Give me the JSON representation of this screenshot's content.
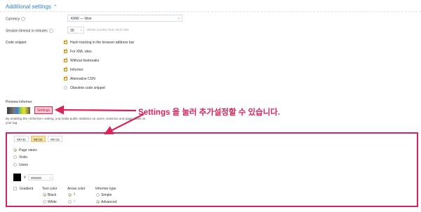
{
  "section": {
    "title": "Additional settings",
    "chevron_icon": "chevron-up-icon"
  },
  "currency": {
    "label": "Currency",
    "value": "KRW — Won"
  },
  "session_timeout": {
    "label": "Session timeout in minutes",
    "value": "30",
    "hint": "Whole number from 30 to 360"
  },
  "code_snippet": {
    "label": "Code snippet",
    "options": [
      {
        "label": "Hash tracking in the browser address bar",
        "checked": true
      },
      {
        "label": "For XML sites",
        "checked": true
      },
      {
        "label": "Without linebreaks",
        "checked": true
      },
      {
        "label": "Informer",
        "checked": true
      },
      {
        "label": "Alternative CDN",
        "checked": true
      },
      {
        "label": "Obsolete code snippet",
        "checked": false
      }
    ]
  },
  "preview": {
    "label": "Preview informer",
    "settings_button": "Settings"
  },
  "callout": {
    "text": "Settings 을 눌러 추가설정할 수 있습니다.",
    "color": "#d8245a"
  },
  "description": "By enabling the «Informer» setting, you make public statistics on users, sessions and page views on your tag.",
  "sizes": [
    "88×31",
    "88×31",
    "80×15"
  ],
  "metric_options": [
    {
      "label": "Page views",
      "selected": true
    },
    {
      "label": "Visits",
      "selected": false
    },
    {
      "label": "Users",
      "selected": false
    }
  ],
  "color": {
    "hash": "#",
    "value": "000000",
    "swatch": "#000000"
  },
  "gradient": {
    "label": "Gradient",
    "checked": false
  },
  "text_color": {
    "title": "Text color",
    "options": [
      {
        "label": "Black",
        "selected": true
      },
      {
        "label": "White",
        "selected": false
      }
    ]
  },
  "arrow_color": {
    "title": "Arrow color"
  },
  "informer_type": {
    "title": "Informer type",
    "options": [
      {
        "label": "Simple",
        "selected": false
      },
      {
        "label": "Advanced",
        "selected": true
      }
    ]
  }
}
